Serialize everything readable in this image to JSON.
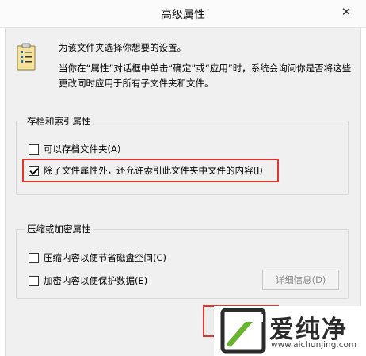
{
  "window": {
    "title": "高级属性",
    "close_glyph": "✕"
  },
  "description": {
    "line1": "为该文件夹选择你想要的设置。",
    "line2": "当你在“属性”对话框中单击“确定”或“应用”时，系统会询问你是否将这些更改同时应用于所有子文件夹和文件。",
    "icon": "folder-settings-icon"
  },
  "archive_group": {
    "title": "存档和索引属性",
    "options": [
      {
        "label": "可以存档文件夹(A)",
        "checked": false
      },
      {
        "label": "除了文件属性外，还允许索引此文件夹中文件的内容(I)",
        "checked": true
      }
    ]
  },
  "compress_group": {
    "title": "压缩或加密属性",
    "options": [
      {
        "label": "压缩内容以便节省磁盘空间(C)",
        "checked": false
      },
      {
        "label": "加密内容以便保护数据(E)",
        "checked": false
      }
    ],
    "details_button": "详细信息(D)",
    "details_enabled": false
  },
  "watermark": {
    "brand": "爱纯净",
    "url": "www.aichunjing.com"
  },
  "colors": {
    "highlight": "#e0362e",
    "dialog_bg": "#f0f0f0",
    "watermark_green": "#6ab52f"
  }
}
